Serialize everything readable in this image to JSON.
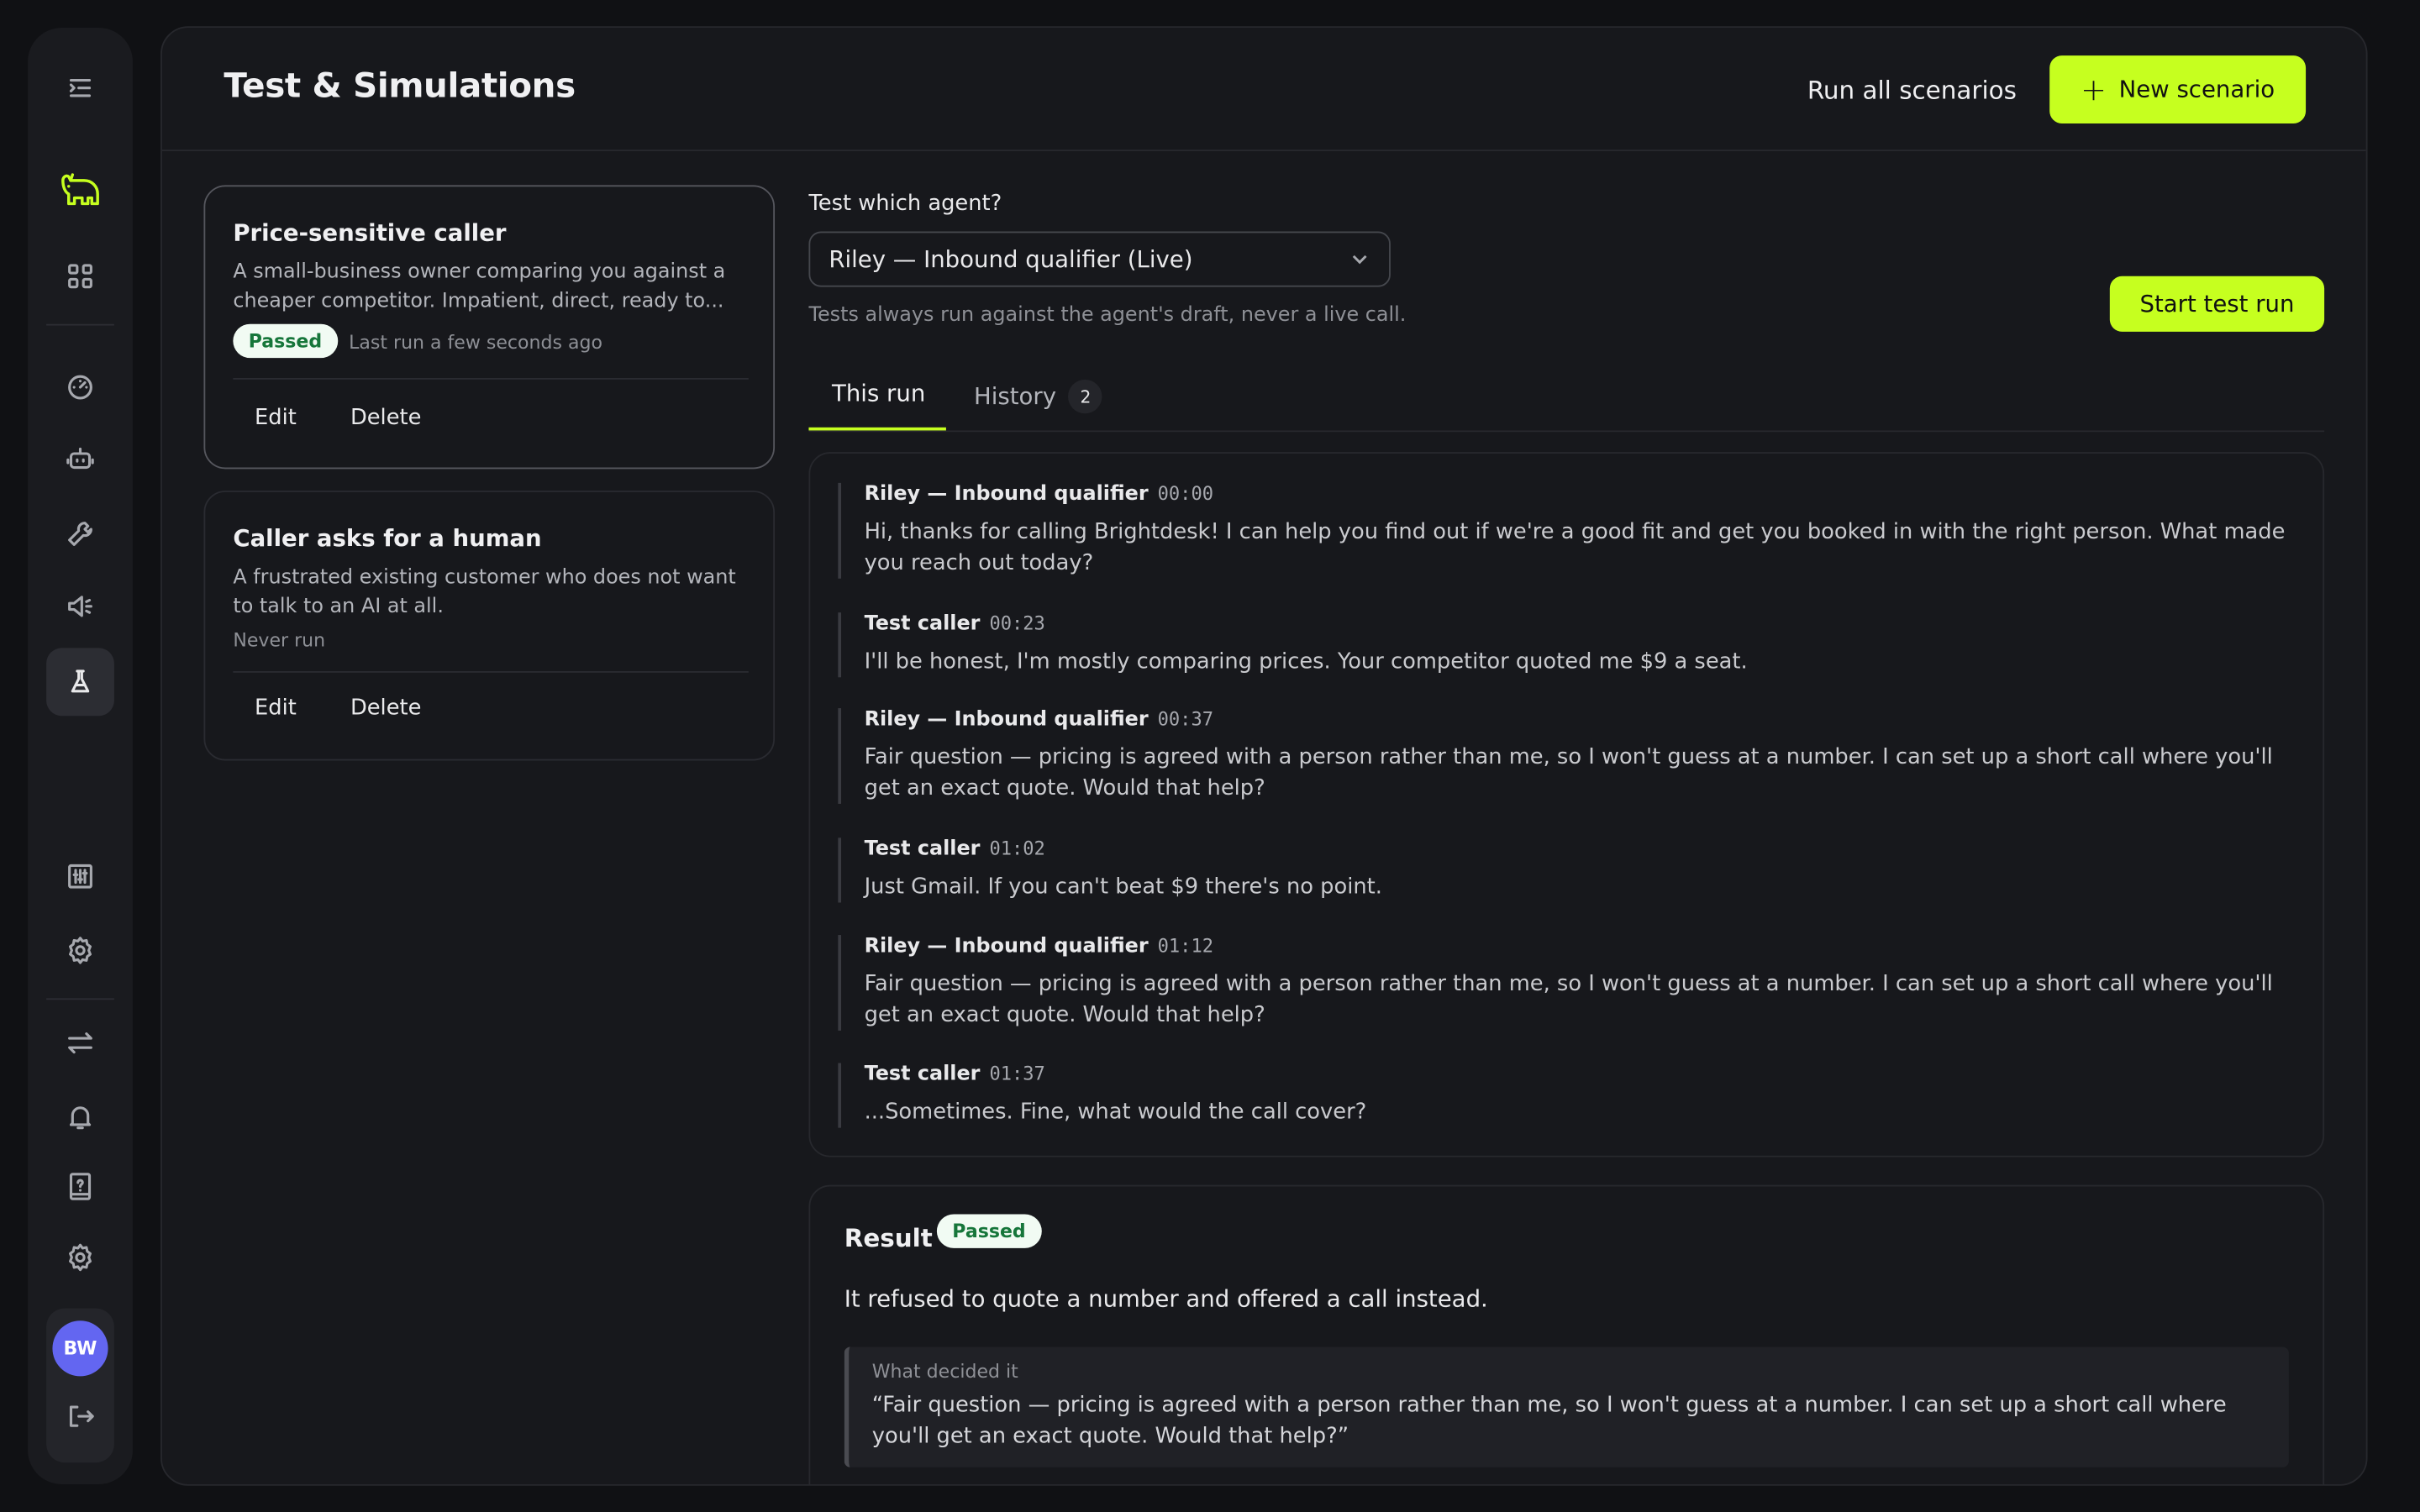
{
  "app": {
    "logo_icon": "bear-logo-icon",
    "accent_color": "#c6ff1f"
  },
  "sidebar": {
    "items": [
      {
        "name": "menu",
        "icon": "collapse-menu-icon"
      },
      {
        "name": "dashboard",
        "icon": "grid-icon"
      },
      {
        "name": "analytics",
        "icon": "gauge-icon"
      },
      {
        "name": "agents",
        "icon": "robot-icon"
      },
      {
        "name": "tools",
        "icon": "wrench-icon"
      },
      {
        "name": "campaigns",
        "icon": "megaphone-icon"
      },
      {
        "name": "tests",
        "icon": "flask-icon",
        "active": true
      },
      {
        "name": "controls",
        "icon": "sliders-icon"
      },
      {
        "name": "settings",
        "icon": "gear-icon"
      },
      {
        "name": "integrations",
        "icon": "swap-arrows-icon"
      },
      {
        "name": "notifications",
        "icon": "bell-icon"
      },
      {
        "name": "help",
        "icon": "help-book-icon"
      },
      {
        "name": "account-settings",
        "icon": "gear-icon"
      }
    ],
    "user_initials": "BW",
    "avatar_color": "#6366f1"
  },
  "header": {
    "title": "Test & Simulations",
    "run_all_label": "Run all scenarios",
    "new_scenario_label": "New scenario"
  },
  "scenarios": [
    {
      "title": "Price-sensitive caller",
      "description": "A small-business owner comparing you against a cheaper competitor. Impatient, direct, ready to...",
      "status": "Passed",
      "last_run": "Last run a few seconds ago",
      "edit_label": "Edit",
      "delete_label": "Delete",
      "selected": true
    },
    {
      "title": "Caller asks for a human",
      "description": "A frustrated existing customer who does not want to talk to an AI at all.",
      "status": "",
      "last_run": "Never run",
      "edit_label": "Edit",
      "delete_label": "Delete",
      "selected": false
    }
  ],
  "test_config": {
    "label": "Test which agent?",
    "selected_agent": "Riley — Inbound qualifier (Live)",
    "help_text": "Tests always run against the agent's draft, never a live call.",
    "start_label": "Start test run"
  },
  "tabs": {
    "this_run": "This run",
    "history": "History",
    "history_count": "2"
  },
  "transcript": [
    {
      "speaker": "Riley — Inbound qualifier",
      "time": "00:00",
      "text": "Hi, thanks for calling Brightdesk! I can help you find out if we're a good fit and get you booked in with the right person. What made you reach out today?"
    },
    {
      "speaker": "Test caller",
      "time": "00:23",
      "text": "I'll be honest, I'm mostly comparing prices. Your competitor quoted me $9 a seat."
    },
    {
      "speaker": "Riley — Inbound qualifier",
      "time": "00:37",
      "text": "Fair question — pricing is agreed with a person rather than me, so I won't guess at a number. I can set up a short call where you'll get an exact quote. Would that help?"
    },
    {
      "speaker": "Test caller",
      "time": "01:02",
      "text": "Just Gmail. If you can't beat $9 there's no point."
    },
    {
      "speaker": "Riley — Inbound qualifier",
      "time": "01:12",
      "text": "Fair question — pricing is agreed with a person rather than me, so I won't guess at a number. I can set up a short call where you'll get an exact quote. Would that help?"
    },
    {
      "speaker": "Test caller",
      "time": "01:37",
      "text": "...Sometimes. Fine, what would the call cover?"
    }
  ],
  "result": {
    "title": "Result",
    "status": "Passed",
    "summary": "It refused to quote a number and offered a call instead.",
    "evidence_label": "What decided it",
    "evidence_quote": "“Fair question — pricing is agreed with a person rather than me, so I won't guess at a number. I can set up a short call where you'll get an exact quote. Would that help?”"
  }
}
